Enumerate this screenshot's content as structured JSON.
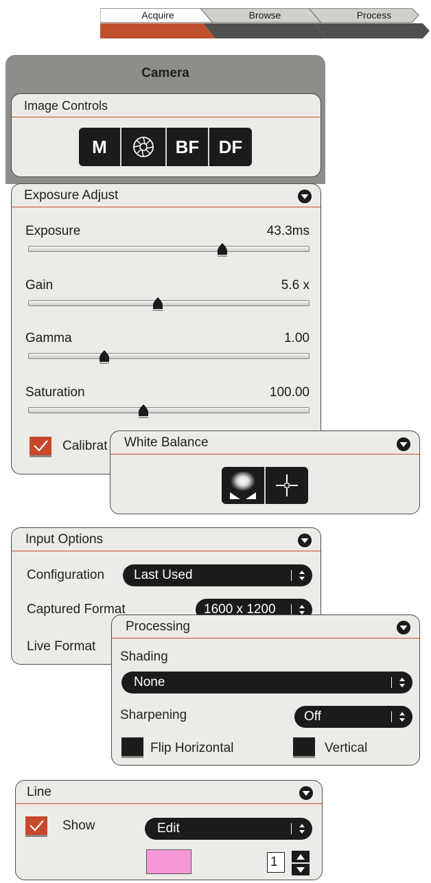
{
  "tabs": {
    "items": [
      {
        "label": "Acquire",
        "active": true
      },
      {
        "label": "Browse",
        "active": false
      },
      {
        "label": "Process",
        "active": false
      }
    ],
    "active_color": "#c0502e"
  },
  "camera": {
    "title": "Camera",
    "image_controls": {
      "title": "Image Controls",
      "buttons": [
        {
          "label": "M",
          "name": "manual"
        },
        {
          "label": "",
          "name": "aperture-icon"
        },
        {
          "label": "BF",
          "name": "brightfield"
        },
        {
          "label": "DF",
          "name": "darkfield"
        }
      ]
    },
    "exposure_adjust": {
      "title": "Exposure Adjust",
      "sliders": [
        {
          "label": "Exposure",
          "value": "43.3ms",
          "fraction": 0.69
        },
        {
          "label": "Gain",
          "value": "5.6 x",
          "fraction": 0.46
        },
        {
          "label": "Gamma",
          "value": "1.00",
          "fraction": 0.27
        },
        {
          "label": "Saturation",
          "value": "100.00",
          "fraction": 0.41
        }
      ],
      "calibrate_label": "Calibrat",
      "calibrate_checked": true
    },
    "white_balance": {
      "title": "White Balance",
      "buttons": [
        "auto-white-balance-icon",
        "crosshair-icon"
      ]
    }
  },
  "input_options": {
    "title": "Input Options",
    "configuration_label": "Configuration",
    "configuration_value": "Last Used",
    "captured_format_label": "Captured Format",
    "captured_format_value": "1600 x 1200",
    "live_format_label": "Live Format"
  },
  "processing": {
    "title": "Processing",
    "shading_label": "Shading",
    "shading_value": "None",
    "sharpening_label": "Sharpening",
    "sharpening_value": "Off",
    "flip_horizontal_label": "Flip Horizontal",
    "flip_horizontal_checked": false,
    "vertical_label": "Vertical",
    "vertical_checked": false
  },
  "line": {
    "title": "Line",
    "show_label": "Show",
    "show_checked": true,
    "mode_value": "Edit",
    "color": "#f799d8",
    "width_value": "1"
  }
}
